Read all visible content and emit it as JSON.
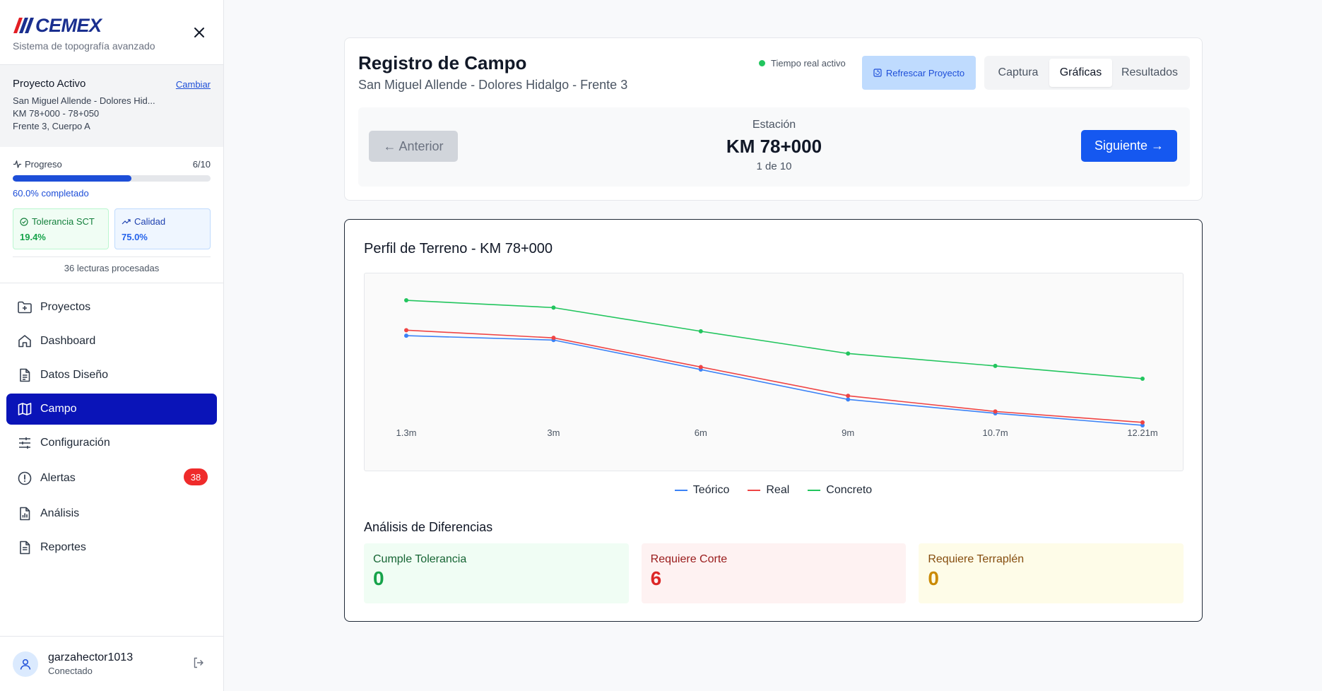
{
  "brand": {
    "name": "CEMEX",
    "subtitle": "Sistema de topografía avanzado"
  },
  "project": {
    "heading": "Proyecto Activo",
    "change_label": "Cambiar",
    "name": "San Miguel Allende - Dolores Hid...",
    "range": "KM 78+000 - 78+050",
    "front": "Frente 3, Cuerpo A"
  },
  "progress": {
    "label": "Progreso",
    "count": "6/10",
    "fraction": 0.6,
    "text": "60.0% completado"
  },
  "metrics": {
    "tolerance": {
      "label": "Tolerancia SCT",
      "value": "19.4%"
    },
    "quality": {
      "label": "Calidad",
      "value": "75.0%"
    }
  },
  "readings": "36 lecturas procesadas",
  "nav": [
    {
      "label": "Proyectos",
      "icon": "folder-plus-icon"
    },
    {
      "label": "Dashboard",
      "icon": "home-icon"
    },
    {
      "label": "Datos Diseño",
      "icon": "file-text-icon"
    },
    {
      "label": "Campo",
      "icon": "map-icon",
      "active": true
    },
    {
      "label": "Configuración",
      "icon": "sliders-icon"
    },
    {
      "label": "Alertas",
      "icon": "alert-circle-icon",
      "badge": "38"
    },
    {
      "label": "Análisis",
      "icon": "file-chart-icon"
    },
    {
      "label": "Reportes",
      "icon": "file-icon"
    }
  ],
  "user": {
    "name": "garzahector1013",
    "status": "Conectado"
  },
  "header": {
    "title": "Registro de Campo",
    "subtitle": "San Miguel Allende - Dolores Hidalgo - Frente 3",
    "live_label": "Tiempo real activo",
    "refresh_label": "Refrescar Proyecto",
    "tabs": [
      "Captura",
      "Gráficas",
      "Resultados"
    ],
    "active_tab": "Gráficas"
  },
  "station": {
    "label": "Estación",
    "value": "KM 78+000",
    "count": "1 de 10",
    "prev_label": "← Anterior",
    "next_label": "Siguiente →"
  },
  "chart_data": {
    "type": "line",
    "title": "Perfil de Terreno - KM 78+000",
    "categories": [
      "1.3m",
      "3m",
      "6m",
      "9m",
      "10.7m",
      "12.21m"
    ],
    "series": [
      {
        "name": "Teórico",
        "color": "#3b82f6",
        "values": [
          2.48,
          2.36,
          1.55,
          0.73,
          0.35,
          0.02
        ]
      },
      {
        "name": "Real",
        "color": "#ef4444",
        "values": [
          2.63,
          2.42,
          1.62,
          0.83,
          0.4,
          0.1
        ]
      },
      {
        "name": "Concreto",
        "color": "#22c55e",
        "values": [
          3.45,
          3.25,
          2.6,
          1.99,
          1.65,
          1.3
        ]
      }
    ],
    "ylim": [
      0,
      3.8
    ],
    "grid": false,
    "legend": "bottom"
  },
  "differences": {
    "title": "Análisis de Diferencias",
    "ok": {
      "label": "Cumple Tolerancia",
      "value": "0"
    },
    "cut": {
      "label": "Requiere Corte",
      "value": "6"
    },
    "fill": {
      "label": "Requiere Terraplén",
      "value": "0"
    }
  }
}
